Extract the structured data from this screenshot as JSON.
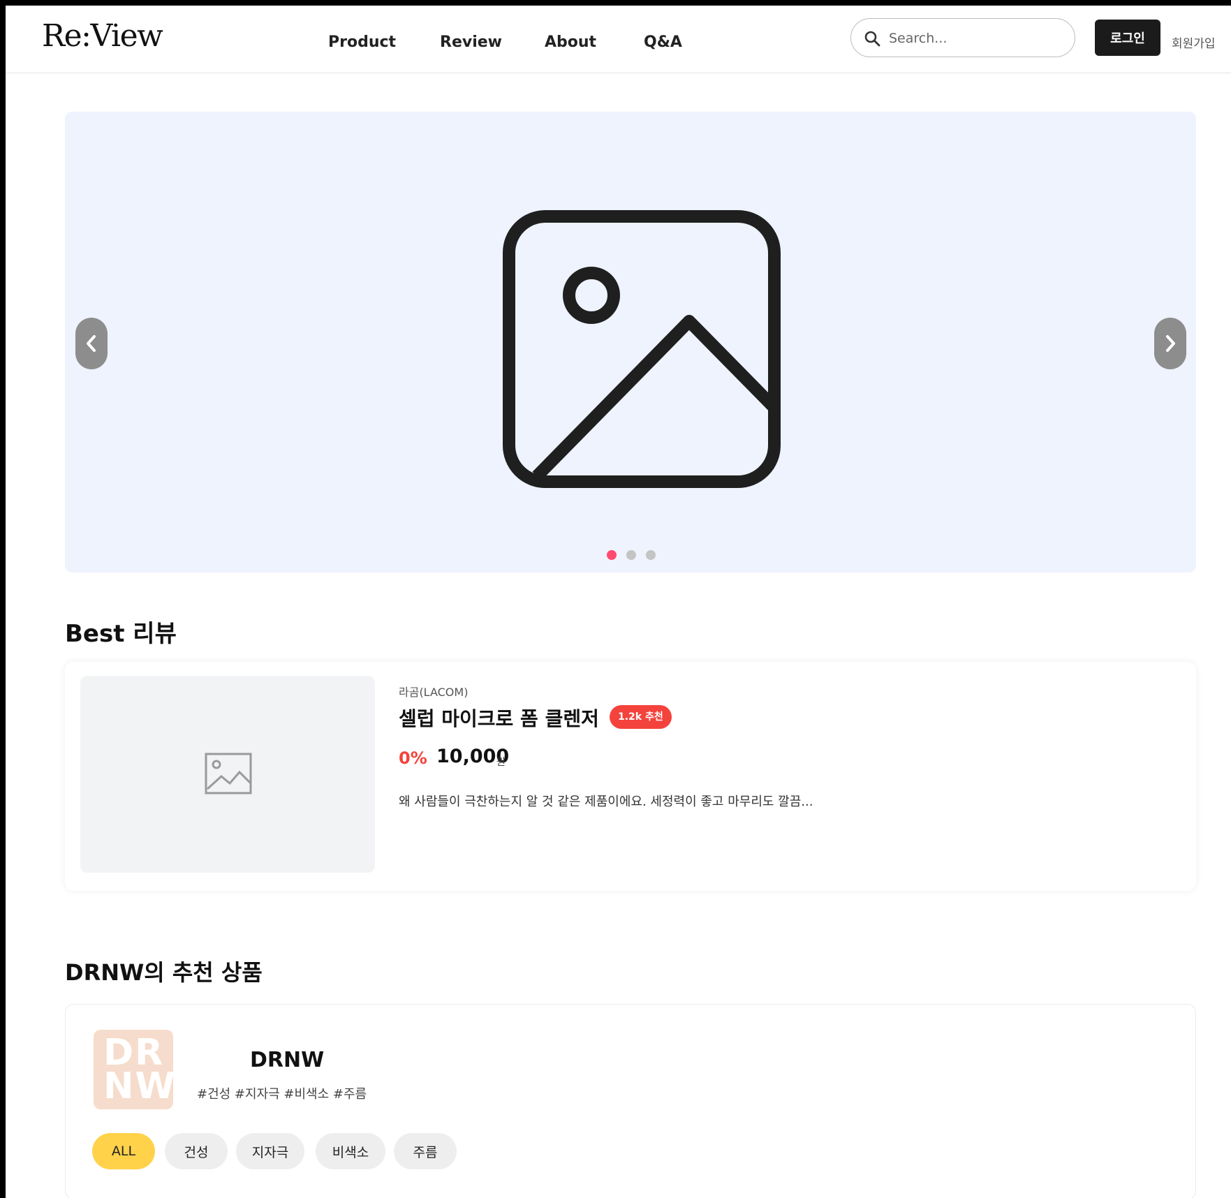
{
  "header": {
    "logo": "Re:View",
    "nav": [
      "Product",
      "Review",
      "About",
      "Q&A"
    ],
    "search_placeholder": "Search...",
    "login_label": "로그인",
    "signup_label": "회원가입"
  },
  "hero": {
    "image_icon": "image-placeholder-icon",
    "prev_icon": "chevron-left-icon",
    "next_icon": "chevron-right-icon",
    "slide_count": 3,
    "active_slide": 1,
    "active_dot_color": "#ff4c6e"
  },
  "best_review": {
    "title": "Best 리뷰",
    "brand": "라곰(LACOM)",
    "product_name": "셀럽 마이크로 폼 클렌저",
    "badge": "1.2k 추천",
    "discount": "0%",
    "price": "10,000",
    "currency": "원",
    "review_text": "왜 사람들이 극찬하는지 알 것 같은 제품이에요. 세정력이 좋고 마무리도 깔끔...",
    "accent_color": "#f4433c"
  },
  "recommend": {
    "title": "DRNW의 추천 상품",
    "avatar_line1": "DR",
    "avatar_line2": "NW",
    "store_name": "DRNW",
    "tags": "#건성 #지자극 #비색소 #주름",
    "chips": [
      "ALL",
      "건성",
      "지자극",
      "비색소",
      "주름"
    ],
    "active_chip": "ALL",
    "active_chip_color": "#ffd24a"
  }
}
